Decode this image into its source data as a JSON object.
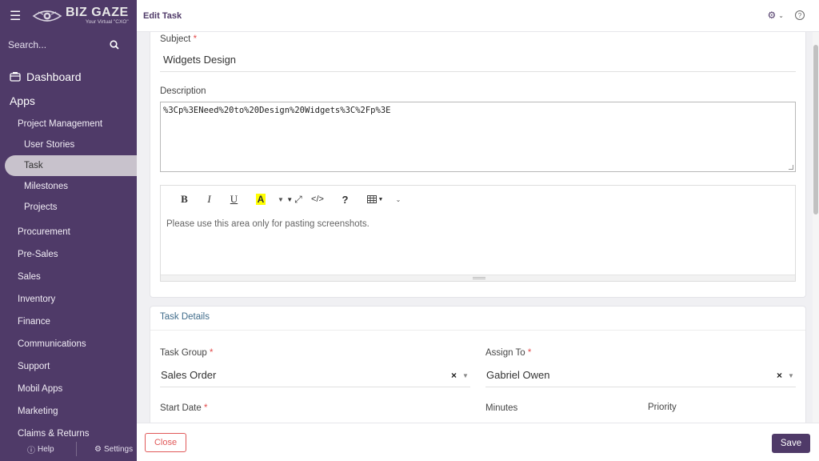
{
  "app": {
    "brand_name": "BIZ GAZE",
    "brand_tagline": "Your Virtual \"CXO\""
  },
  "sidebar": {
    "search_placeholder": "Search...",
    "dashboard_label": "Dashboard",
    "apps_label": "Apps",
    "items": [
      {
        "label": "Project Management",
        "level": 1
      },
      {
        "label": "User Stories",
        "level": 2
      },
      {
        "label": "Task",
        "level": 2,
        "active": true
      },
      {
        "label": "Milestones",
        "level": 2
      },
      {
        "label": "Projects",
        "level": 2
      },
      {
        "label": "Procurement",
        "level": 1
      },
      {
        "label": "Pre-Sales",
        "level": 1
      },
      {
        "label": "Sales",
        "level": 1
      },
      {
        "label": "Inventory",
        "level": 1
      },
      {
        "label": "Finance",
        "level": 1
      },
      {
        "label": "Communications",
        "level": 1
      },
      {
        "label": "Support",
        "level": 1
      },
      {
        "label": "Mobil Apps",
        "level": 1
      },
      {
        "label": "Marketing",
        "level": 1
      },
      {
        "label": "Claims & Returns",
        "level": 1
      }
    ],
    "footer": {
      "help_label": "Help",
      "settings_label": "Settings"
    }
  },
  "header": {
    "title": "Edit Task",
    "icons": [
      "gear-icon",
      "chevron-down-icon",
      "help-circle-icon"
    ]
  },
  "form": {
    "subject_label": "Subject",
    "subject_value": "Widgets Design",
    "description_label": "Description",
    "description_value": "%3Cp%3ENeed%20to%20Design%20Widgets%3C%2Fp%3E",
    "editor_placeholder": "Please use this area only for pasting screenshots.",
    "toolbar": {
      "bold": "B",
      "italic": "I",
      "underline": "U",
      "highlight": "A",
      "code": "</>",
      "help": "?"
    },
    "task_details_title": "Task Details",
    "task_group_label": "Task Group",
    "task_group_value": "Sales Order",
    "assign_to_label": "Assign To",
    "assign_to_value": "Gabriel Owen",
    "start_date_label": "Start Date",
    "minutes_label": "Minutes",
    "priority_label": "Priority",
    "required_marker": "*"
  },
  "footer": {
    "close_label": "Close",
    "save_label": "Save"
  },
  "colors": {
    "brand": "#4f3a68",
    "close_red": "#e05858",
    "required_red": "#e24b4b",
    "section_title": "#3f6b8a"
  }
}
